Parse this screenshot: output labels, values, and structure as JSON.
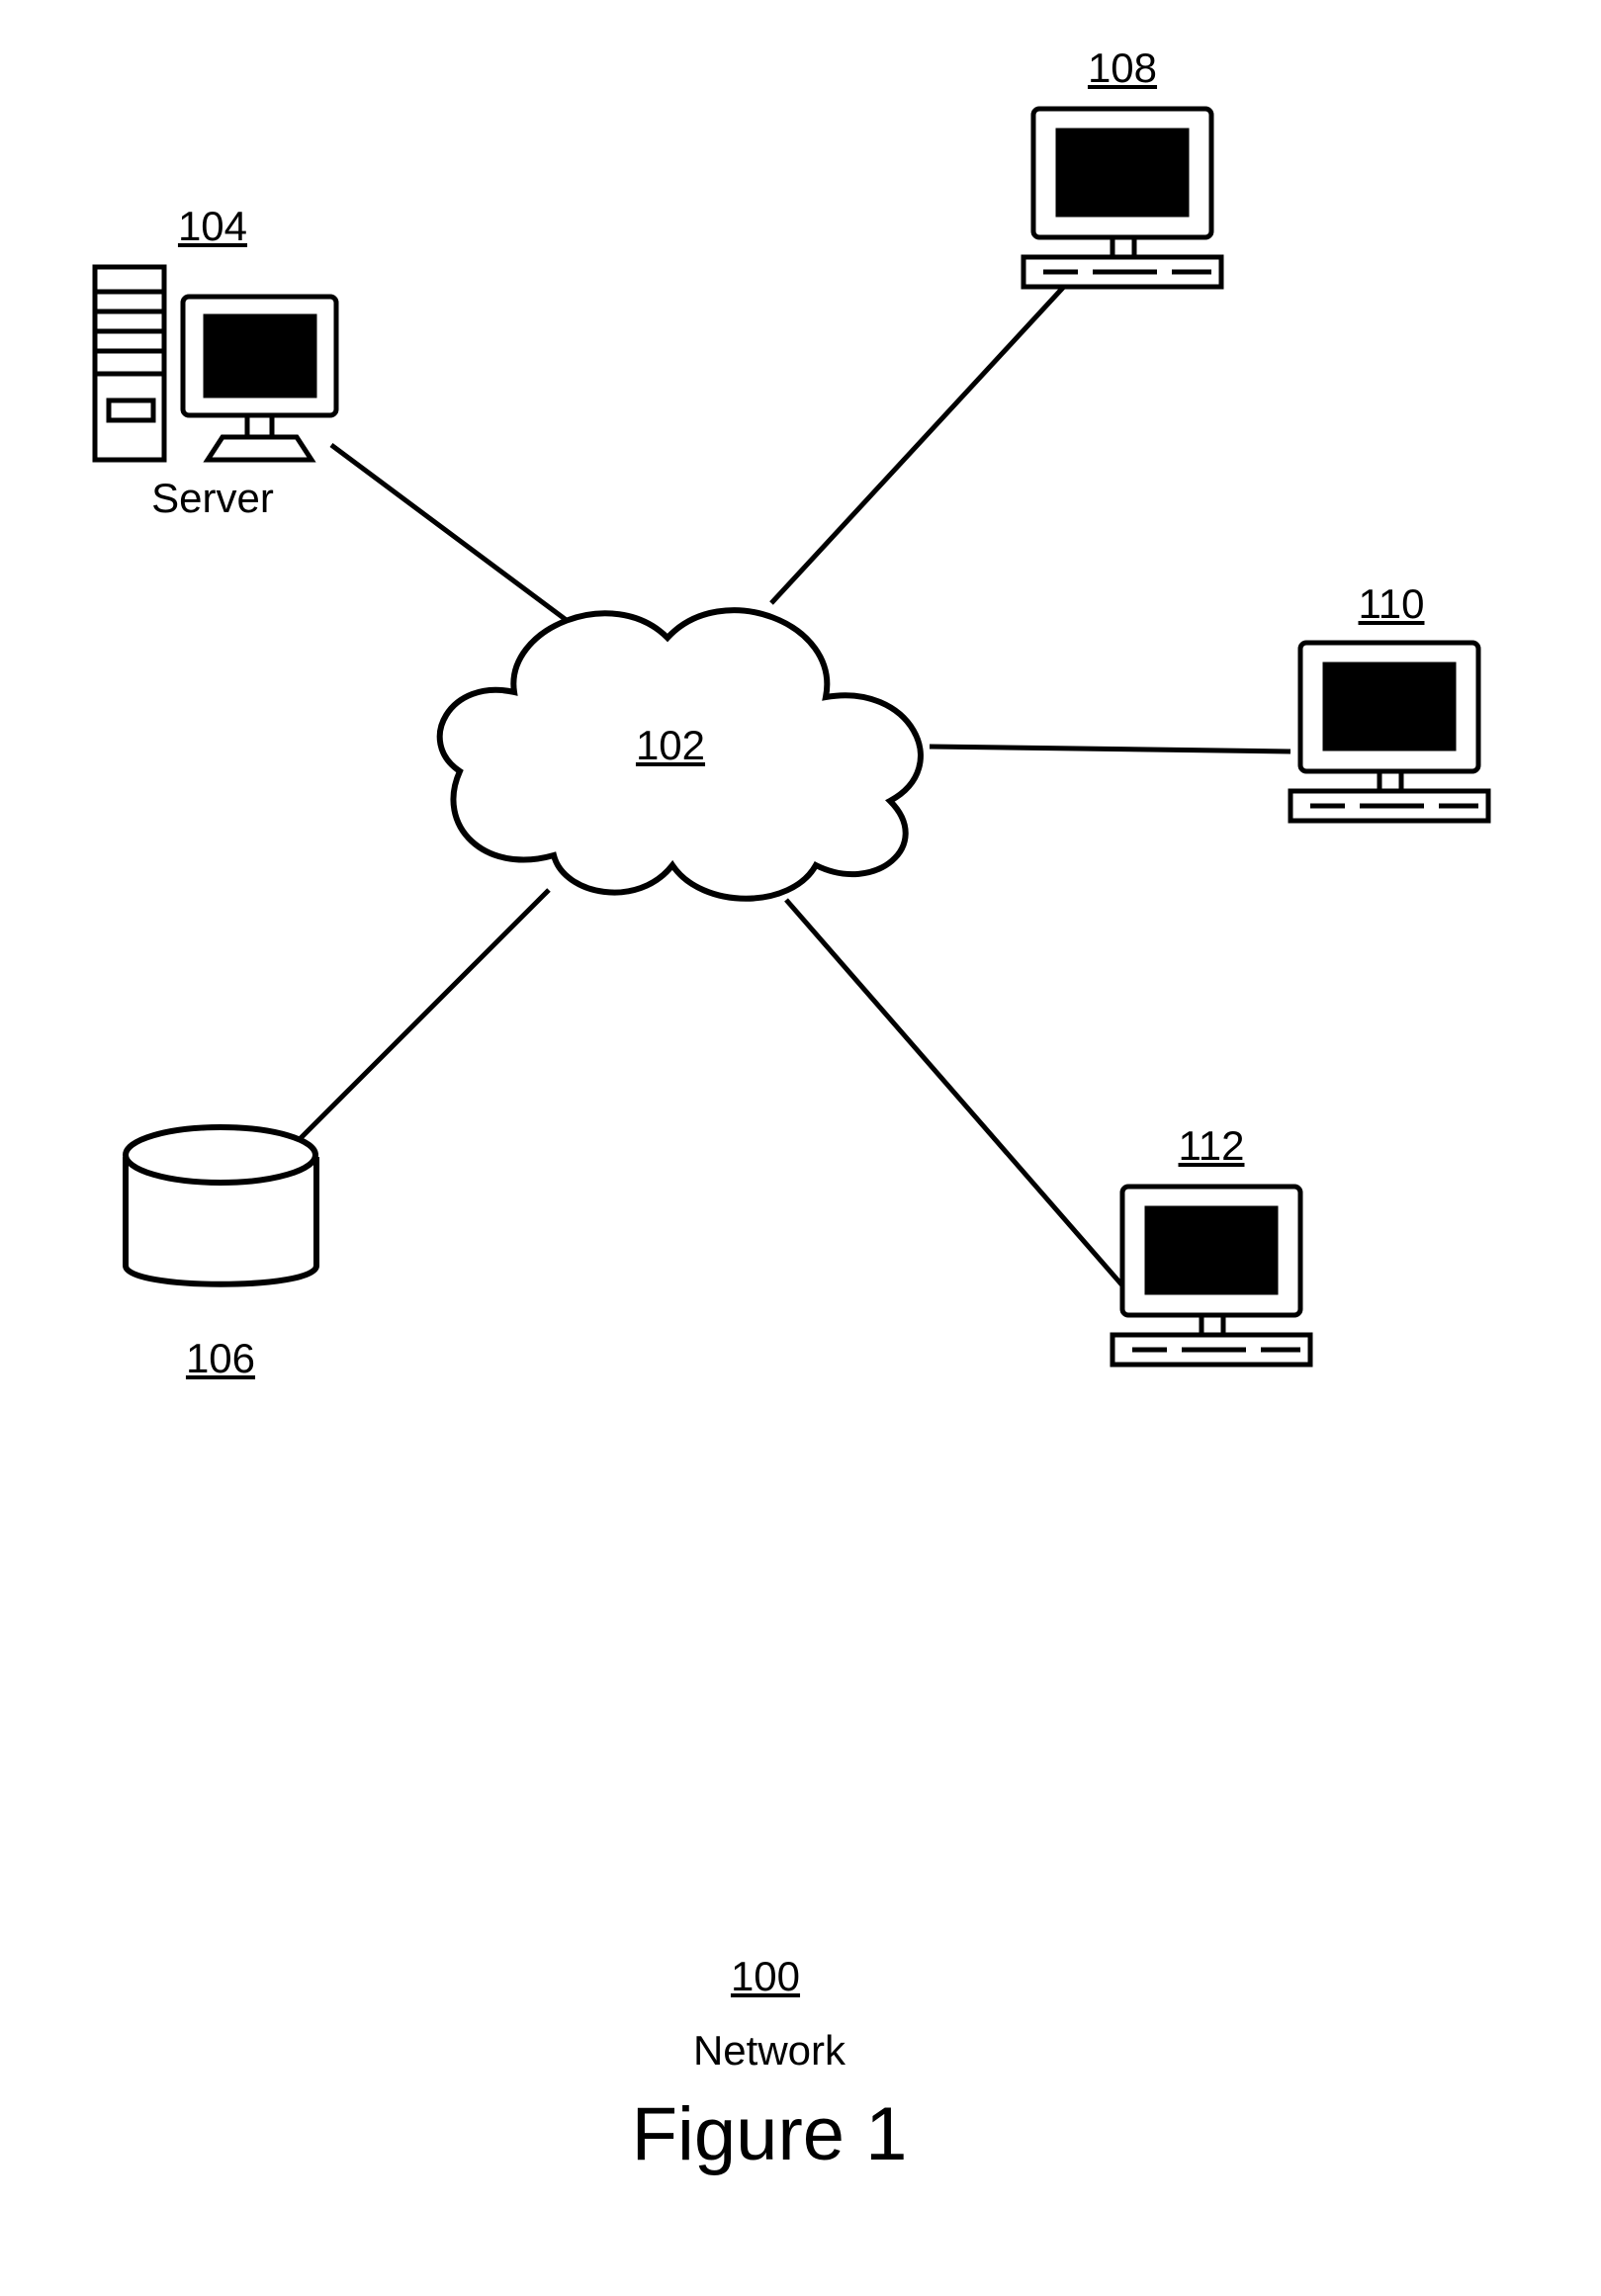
{
  "labels": {
    "cloud_ref": "102",
    "server_ref": "104",
    "server_word": "Server",
    "db_ref": "106",
    "client1_ref": "108",
    "client2_ref": "110",
    "client3_ref": "112",
    "overall_ref": "100",
    "overall_word": "Network",
    "figure": "Figure 1"
  }
}
